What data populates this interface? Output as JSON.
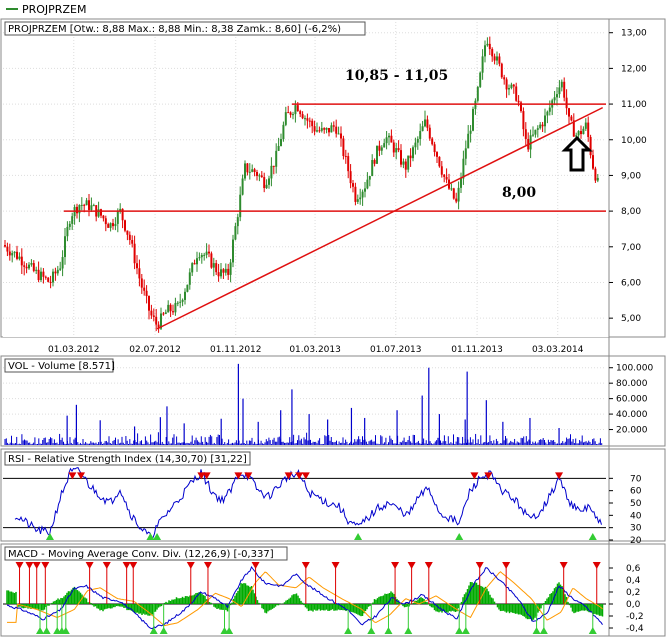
{
  "tab": {
    "label": "PROJPRZEM"
  },
  "panels": {
    "price": {
      "legend": "PROJPRZEM [Otw.: 8,88  Max.: 8,88  Min.: 8,38  Zamk.: 8,60] (-6,2%)"
    },
    "volume": {
      "legend": "VOL - Volume [8.571]"
    },
    "rsi": {
      "legend": "RSI - Relative Strength Index (14,30,70) [31,22]"
    },
    "macd": {
      "legend": "MACD - Moving Average Conv. Div. (12,26,9) [-0,337]"
    }
  },
  "colors": {
    "up_candle": "#2e8b2e",
    "down_candle": "#e00000",
    "trendline": "#e01010",
    "volume": "#0000cc",
    "rsi_line": "#0000cc",
    "macd_line": "#0000cc",
    "signal_line": "#ff9900",
    "histogram": "#00aa00",
    "signal_up": "#33cc33",
    "signal_down": "#dd0000"
  },
  "annotations": {
    "resistance_label": "10,85 - 11,05",
    "support_label": "8,00",
    "arrow_icon": "up-arrow-icon"
  },
  "chart_data": [
    {
      "type": "line",
      "panel": "price",
      "x_tick_labels": [
        "01.03.2012",
        "02.07.2012",
        "01.11.2012",
        "01.03.2013",
        "01.07.2013",
        "01.11.2013",
        "03.03.2014"
      ],
      "y_ticks": [
        "5,00",
        "6,00",
        "7,00",
        "8,00",
        "9,00",
        "10,00",
        "11,00",
        "12,00",
        "13,00"
      ],
      "ylim": [
        4.5,
        13.3
      ],
      "x_range": [
        "2011-11-15",
        "2014-05-15"
      ],
      "price_path": [
        [
          "2011-11-15",
          7.05
        ],
        [
          "2011-12-10",
          6.7
        ],
        [
          "2012-01-01",
          6.3
        ],
        [
          "2012-01-25",
          6.0
        ],
        [
          "2012-02-10",
          6.5
        ],
        [
          "2012-02-25",
          7.9
        ],
        [
          "2012-03-10",
          8.2
        ],
        [
          "2012-03-25",
          8.15
        ],
        [
          "2012-04-10",
          7.9
        ],
        [
          "2012-04-25",
          7.6
        ],
        [
          "2012-05-10",
          8.0
        ],
        [
          "2012-05-25",
          7.2
        ],
        [
          "2012-06-10",
          6.0
        ],
        [
          "2012-06-25",
          5.1
        ],
        [
          "2012-07-05",
          4.8
        ],
        [
          "2012-07-20",
          5.2
        ],
        [
          "2012-08-05",
          5.3
        ],
        [
          "2012-08-20",
          6.0
        ],
        [
          "2012-09-05",
          6.9
        ],
        [
          "2012-09-20",
          6.7
        ],
        [
          "2012-10-05",
          6.3
        ],
        [
          "2012-10-20",
          6.2
        ],
        [
          "2012-11-01",
          7.6
        ],
        [
          "2012-11-15",
          9.2
        ],
        [
          "2012-12-01",
          9.1
        ],
        [
          "2012-12-15",
          8.8
        ],
        [
          "2013-01-01",
          9.5
        ],
        [
          "2013-01-15",
          10.6
        ],
        [
          "2013-02-01",
          11.0
        ],
        [
          "2013-02-15",
          10.6
        ],
        [
          "2013-03-01",
          10.3
        ],
        [
          "2013-03-15",
          10.2
        ],
        [
          "2013-04-01",
          10.4
        ],
        [
          "2013-04-15",
          9.5
        ],
        [
          "2013-05-01",
          8.4
        ],
        [
          "2013-05-15",
          8.7
        ],
        [
          "2013-06-01",
          9.6
        ],
        [
          "2013-06-15",
          10.1
        ],
        [
          "2013-07-01",
          9.7
        ],
        [
          "2013-07-15",
          9.2
        ],
        [
          "2013-08-01",
          9.9
        ],
        [
          "2013-08-15",
          10.5
        ],
        [
          "2013-09-01",
          9.6
        ],
        [
          "2013-09-15",
          8.8
        ],
        [
          "2013-10-01",
          8.2
        ],
        [
          "2013-10-15",
          9.8
        ],
        [
          "2013-11-01",
          11.2
        ],
        [
          "2013-11-15",
          12.9
        ],
        [
          "2013-12-01",
          12.2
        ],
        [
          "2013-12-15",
          11.6
        ],
        [
          "2014-01-01",
          11.2
        ],
        [
          "2014-01-15",
          9.8
        ],
        [
          "2014-02-01",
          10.3
        ],
        [
          "2014-02-15",
          10.7
        ],
        [
          "2014-03-01",
          11.4
        ],
        [
          "2014-03-10",
          11.6
        ],
        [
          "2014-03-20",
          10.5
        ],
        [
          "2014-04-01",
          10.1
        ],
        [
          "2014-04-15",
          10.4
        ],
        [
          "2014-04-25",
          9.3
        ],
        [
          "2014-05-05",
          8.6
        ]
      ],
      "lines": [
        {
          "from": [
            "2013-01-25",
            11.0
          ],
          "to": [
            "2014-05-15",
            11.0
          ]
        },
        {
          "from": [
            "2012-02-15",
            8.0
          ],
          "to": [
            "2014-05-15",
            8.0
          ]
        },
        {
          "from": [
            "2012-07-05",
            4.7
          ],
          "to": [
            "2014-05-10",
            10.9
          ]
        }
      ]
    },
    {
      "type": "bar",
      "panel": "volume",
      "y_ticks": [
        "20.000",
        "40.000",
        "60.000",
        "80.000",
        "100.000"
      ],
      "ylim": [
        0,
        110000
      ],
      "spikes": [
        [
          "2012-02-20",
          38000
        ],
        [
          "2012-03-05",
          52000
        ],
        [
          "2012-04-10",
          32000
        ],
        [
          "2012-06-01",
          24000
        ],
        [
          "2012-07-10",
          36000
        ],
        [
          "2012-07-20",
          50000
        ],
        [
          "2012-08-15",
          28000
        ],
        [
          "2012-10-10",
          34000
        ],
        [
          "2012-11-05",
          105000
        ],
        [
          "2012-11-12",
          60000
        ],
        [
          "2012-12-05",
          30000
        ],
        [
          "2013-01-08",
          45000
        ],
        [
          "2013-01-25",
          72000
        ],
        [
          "2013-02-20",
          40000
        ],
        [
          "2013-03-20",
          33000
        ],
        [
          "2013-04-25",
          48000
        ],
        [
          "2013-05-15",
          35000
        ],
        [
          "2013-07-03",
          45000
        ],
        [
          "2013-08-10",
          64000
        ],
        [
          "2013-08-20",
          100000
        ],
        [
          "2013-09-05",
          40000
        ],
        [
          "2013-10-14",
          33000
        ],
        [
          "2013-10-17",
          95000
        ],
        [
          "2013-11-15",
          58000
        ],
        [
          "2013-12-10",
          30000
        ],
        [
          "2014-01-20",
          35000
        ],
        [
          "2014-03-05",
          22000
        ]
      ]
    },
    {
      "type": "line",
      "panel": "rsi",
      "y_ticks": [
        "20",
        "30",
        "40",
        "50",
        "60",
        "70"
      ],
      "ylim": [
        20,
        80
      ],
      "levels": [
        30,
        70
      ],
      "path": [
        [
          "2011-11-15",
          45
        ],
        [
          "2011-12-10",
          38
        ],
        [
          "2012-01-05",
          28
        ],
        [
          "2012-01-25",
          26
        ],
        [
          "2012-02-10",
          55
        ],
        [
          "2012-02-25",
          75
        ],
        [
          "2012-03-10",
          76
        ],
        [
          "2012-03-25",
          64
        ],
        [
          "2012-04-10",
          56
        ],
        [
          "2012-04-25",
          50
        ],
        [
          "2012-05-10",
          62
        ],
        [
          "2012-05-25",
          42
        ],
        [
          "2012-06-10",
          30
        ],
        [
          "2012-06-25",
          22
        ],
        [
          "2012-07-10",
          35
        ],
        [
          "2012-07-25",
          45
        ],
        [
          "2012-08-10",
          55
        ],
        [
          "2012-08-25",
          66
        ],
        [
          "2012-09-10",
          75
        ],
        [
          "2012-09-25",
          60
        ],
        [
          "2012-10-10",
          52
        ],
        [
          "2012-10-25",
          60
        ],
        [
          "2012-11-05",
          75
        ],
        [
          "2012-11-20",
          72
        ],
        [
          "2012-12-05",
          60
        ],
        [
          "2012-12-20",
          55
        ],
        [
          "2013-01-05",
          64
        ],
        [
          "2013-01-20",
          72
        ],
        [
          "2013-02-05",
          73
        ],
        [
          "2013-02-20",
          58
        ],
        [
          "2013-03-05",
          55
        ],
        [
          "2013-03-20",
          50
        ],
        [
          "2013-04-05",
          48
        ],
        [
          "2013-04-20",
          36
        ],
        [
          "2013-05-05",
          30
        ],
        [
          "2013-05-20",
          38
        ],
        [
          "2013-06-05",
          46
        ],
        [
          "2013-06-20",
          50
        ],
        [
          "2013-07-05",
          45
        ],
        [
          "2013-07-20",
          40
        ],
        [
          "2013-08-05",
          55
        ],
        [
          "2013-08-20",
          62
        ],
        [
          "2013-09-05",
          42
        ],
        [
          "2013-09-20",
          38
        ],
        [
          "2013-10-05",
          33
        ],
        [
          "2013-10-20",
          58
        ],
        [
          "2013-11-05",
          70
        ],
        [
          "2013-11-20",
          74
        ],
        [
          "2013-12-05",
          62
        ],
        [
          "2013-12-20",
          56
        ],
        [
          "2014-01-05",
          48
        ],
        [
          "2014-01-20",
          36
        ],
        [
          "2014-02-05",
          44
        ],
        [
          "2014-02-20",
          56
        ],
        [
          "2014-03-05",
          70
        ],
        [
          "2014-03-20",
          52
        ],
        [
          "2014-04-05",
          42
        ],
        [
          "2014-04-20",
          48
        ],
        [
          "2014-05-01",
          36
        ],
        [
          "2014-05-10",
          31
        ]
      ],
      "overbought": [
        "2012-02-28",
        "2012-03-12",
        "2012-09-10",
        "2012-09-18",
        "2012-11-05",
        "2012-11-20",
        "2013-01-20",
        "2013-02-05",
        "2013-02-15",
        "2013-10-28",
        "2013-11-18",
        "2014-03-05"
      ],
      "oversold": [
        "2012-01-25",
        "2012-06-25",
        "2012-07-05",
        "2013-05-05",
        "2013-10-05",
        "2014-04-25"
      ]
    },
    {
      "type": "line",
      "panel": "macd",
      "y_ticks": [
        "-0,4",
        "-0,2",
        "0,0",
        "0,2",
        "0,4",
        "0,6"
      ],
      "ylim": [
        -0.5,
        0.7
      ],
      "macd": [
        [
          "2011-11-15",
          0.0
        ],
        [
          "2011-12-15",
          -0.1
        ],
        [
          "2012-01-15",
          -0.25
        ],
        [
          "2012-02-10",
          -0.1
        ],
        [
          "2012-03-01",
          0.25
        ],
        [
          "2012-03-20",
          0.3
        ],
        [
          "2012-04-15",
          0.1
        ],
        [
          "2012-05-10",
          0.05
        ],
        [
          "2012-06-01",
          -0.15
        ],
        [
          "2012-06-25",
          -0.4
        ],
        [
          "2012-07-15",
          -0.35
        ],
        [
          "2012-08-15",
          -0.1
        ],
        [
          "2012-09-10",
          0.2
        ],
        [
          "2012-10-01",
          0.1
        ],
        [
          "2012-10-20",
          -0.05
        ],
        [
          "2012-11-10",
          0.4
        ],
        [
          "2012-11-25",
          0.6
        ],
        [
          "2012-12-15",
          0.35
        ],
        [
          "2013-01-10",
          0.3
        ],
        [
          "2013-01-30",
          0.5
        ],
        [
          "2013-02-20",
          0.3
        ],
        [
          "2013-03-20",
          0.1
        ],
        [
          "2013-04-20",
          -0.1
        ],
        [
          "2013-05-10",
          -0.35
        ],
        [
          "2013-06-01",
          -0.2
        ],
        [
          "2013-06-25",
          0.1
        ],
        [
          "2013-07-15",
          0.0
        ],
        [
          "2013-08-10",
          0.15
        ],
        [
          "2013-09-10",
          -0.1
        ],
        [
          "2013-10-01",
          -0.25
        ],
        [
          "2013-10-25",
          0.3
        ],
        [
          "2013-11-15",
          0.6
        ],
        [
          "2013-12-05",
          0.4
        ],
        [
          "2014-01-01",
          0.1
        ],
        [
          "2014-01-25",
          -0.3
        ],
        [
          "2014-02-15",
          -0.15
        ],
        [
          "2014-03-05",
          0.3
        ],
        [
          "2014-03-25",
          0.1
        ],
        [
          "2014-04-15",
          -0.05
        ],
        [
          "2014-05-10",
          -0.34
        ]
      ],
      "signal_up": [
        "2012-01-10",
        "2012-01-20",
        "2012-02-05",
        "2012-02-12",
        "2012-02-18",
        "2012-06-30",
        "2012-07-15",
        "2012-10-15",
        "2012-10-22",
        "2013-04-20",
        "2013-05-25",
        "2013-06-20",
        "2013-07-20",
        "2013-10-05",
        "2013-10-15",
        "2014-01-30",
        "2014-02-10",
        "2014-04-25"
      ],
      "signal_down": [
        "2011-12-10",
        "2011-12-25",
        "2012-01-05",
        "2012-01-18",
        "2012-03-25",
        "2012-04-20",
        "2012-05-20",
        "2012-05-30",
        "2012-08-25",
        "2012-09-20",
        "2012-12-01",
        "2013-02-15",
        "2013-04-01",
        "2013-06-30",
        "2013-07-25",
        "2013-08-20",
        "2013-11-05",
        "2013-12-15",
        "2014-03-12",
        "2014-05-01"
      ]
    }
  ]
}
